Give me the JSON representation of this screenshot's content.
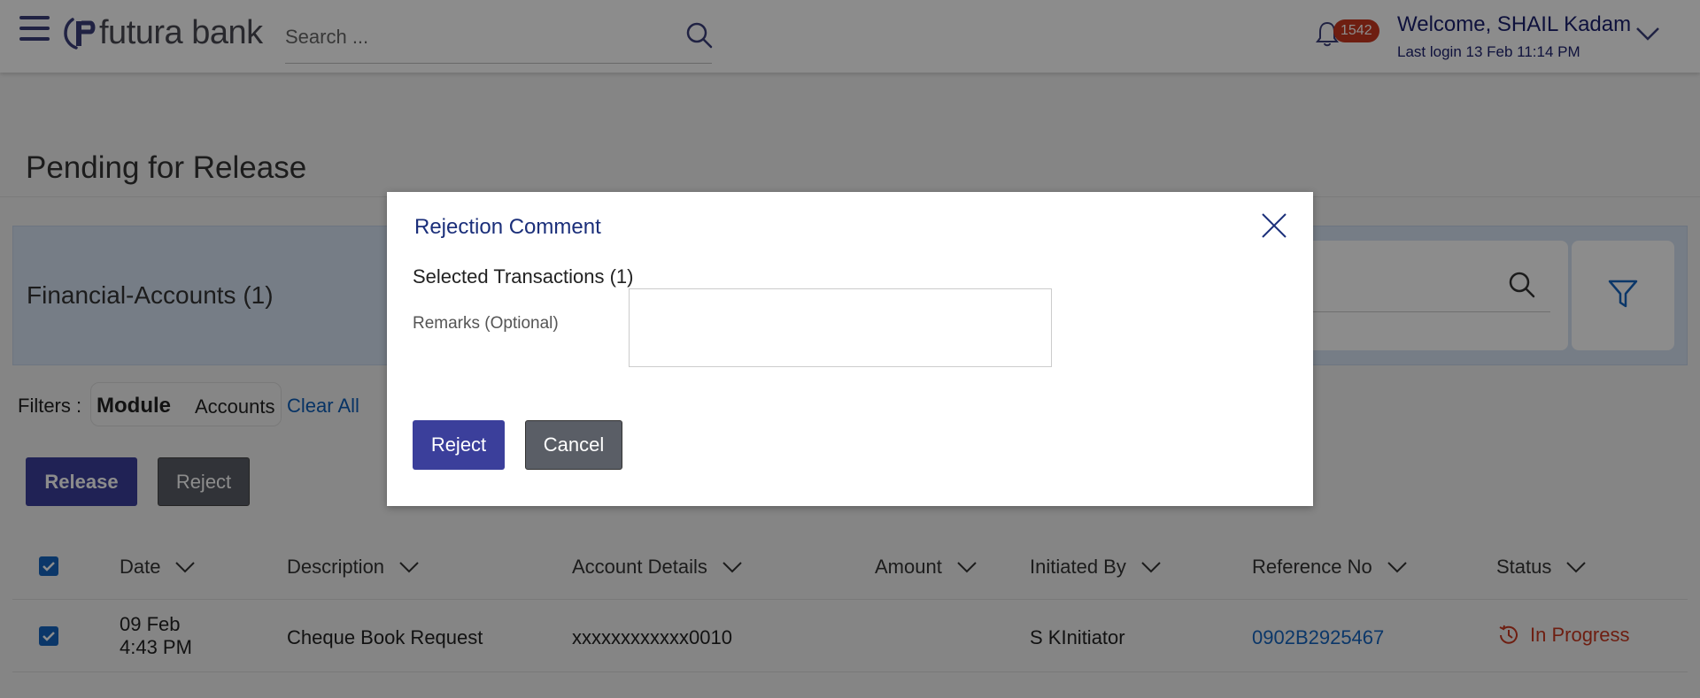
{
  "header": {
    "logo_text": "futura bank",
    "search_placeholder": "Search ...",
    "notification_count": "1542",
    "welcome": "Welcome, SHAIL Kadam",
    "last_login": "Last login 13 Feb 11:14 PM"
  },
  "page": {
    "title": "Pending for Release",
    "account_group": "Financial-Accounts (1)",
    "filters_label": "Filters :",
    "filter_chip": {
      "key": "Module",
      "value": "Accounts"
    },
    "clear_all": "Clear All",
    "release_label": "Release",
    "reject_label": "Reject"
  },
  "table": {
    "columns": [
      "Date",
      "Description",
      "Account Details",
      "Amount",
      "Initiated By",
      "Reference No",
      "Status"
    ],
    "rows": [
      {
        "date_line1": "09 Feb",
        "date_line2": "4:43 PM",
        "description": "Cheque Book Request",
        "account": "xxxxxxxxxxxx0010",
        "amount": "",
        "initiated_by": "S KInitiator",
        "reference": "0902B2925467",
        "status": "In Progress"
      }
    ]
  },
  "modal": {
    "title": "Rejection Comment",
    "selected": "Selected Transactions (1)",
    "remarks_label": "Remarks (Optional)",
    "remarks_value": "",
    "reject_button": "Reject",
    "cancel_button": "Cancel"
  },
  "colors": {
    "primary": "#3b3f9b",
    "secondary": "#5a5e66",
    "link": "#1565c0",
    "status_in_progress": "#c8381f",
    "badge": "#c8381f"
  },
  "icons": [
    "hamburger-icon",
    "search-icon",
    "bell-icon",
    "chevron-down-icon",
    "filter-icon",
    "close-icon",
    "history-icon",
    "checkbox-icon"
  ]
}
